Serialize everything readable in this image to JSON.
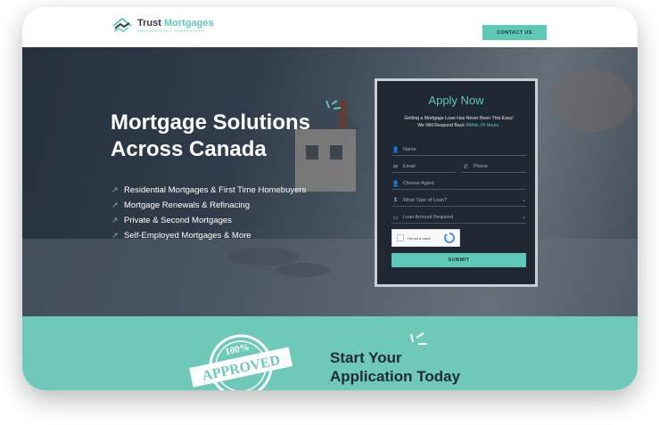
{
  "header": {
    "logo_title_part1": "Trust",
    "logo_title_part2": "Mortgages",
    "logo_tagline": "TRANSPARENCY GUARANTEED",
    "contact_label": "CONTACT US"
  },
  "hero": {
    "title": "Mortgage Solutions Across Canada",
    "features": [
      "Residential Mortgages & First Time Homebuyers",
      "Mortgage Renewals & Refinacing",
      "Private & Second Mortgages",
      "Self-Employed Mortgages & More"
    ]
  },
  "form": {
    "title": "Apply Now",
    "desc_line1": "Getting a Mortgage Loan Has Never Been This Easy!",
    "desc_line2": "We Will Respond Back",
    "desc_highlight": "Within 24 Hours.",
    "name_placeholder": "Name",
    "email_placeholder": "Email",
    "phone_placeholder": "Phone",
    "agent_placeholder": "Choose Agent",
    "loan_type_placeholder": "What Type of Loan?",
    "loan_amount_placeholder": "Loan Amount Required",
    "captcha_label": "I'm not a robot",
    "submit_label": "SUBMIT"
  },
  "bottom": {
    "stamp_top": "100%",
    "stamp_main": "APPROVED",
    "title_line1": "Start Your",
    "title_line2": "Application Today"
  },
  "colors": {
    "accent": "#5ec9b8",
    "dark": "#1f2832",
    "band": "#6fc9b8"
  },
  "icons": [
    "handshake-house-icon",
    "user-icon",
    "mail-icon",
    "phone-icon",
    "dollar-icon",
    "wallet-icon",
    "chevron-down-icon",
    "arrow-up-right-icon",
    "recaptcha-icon",
    "sparkle-icon"
  ]
}
